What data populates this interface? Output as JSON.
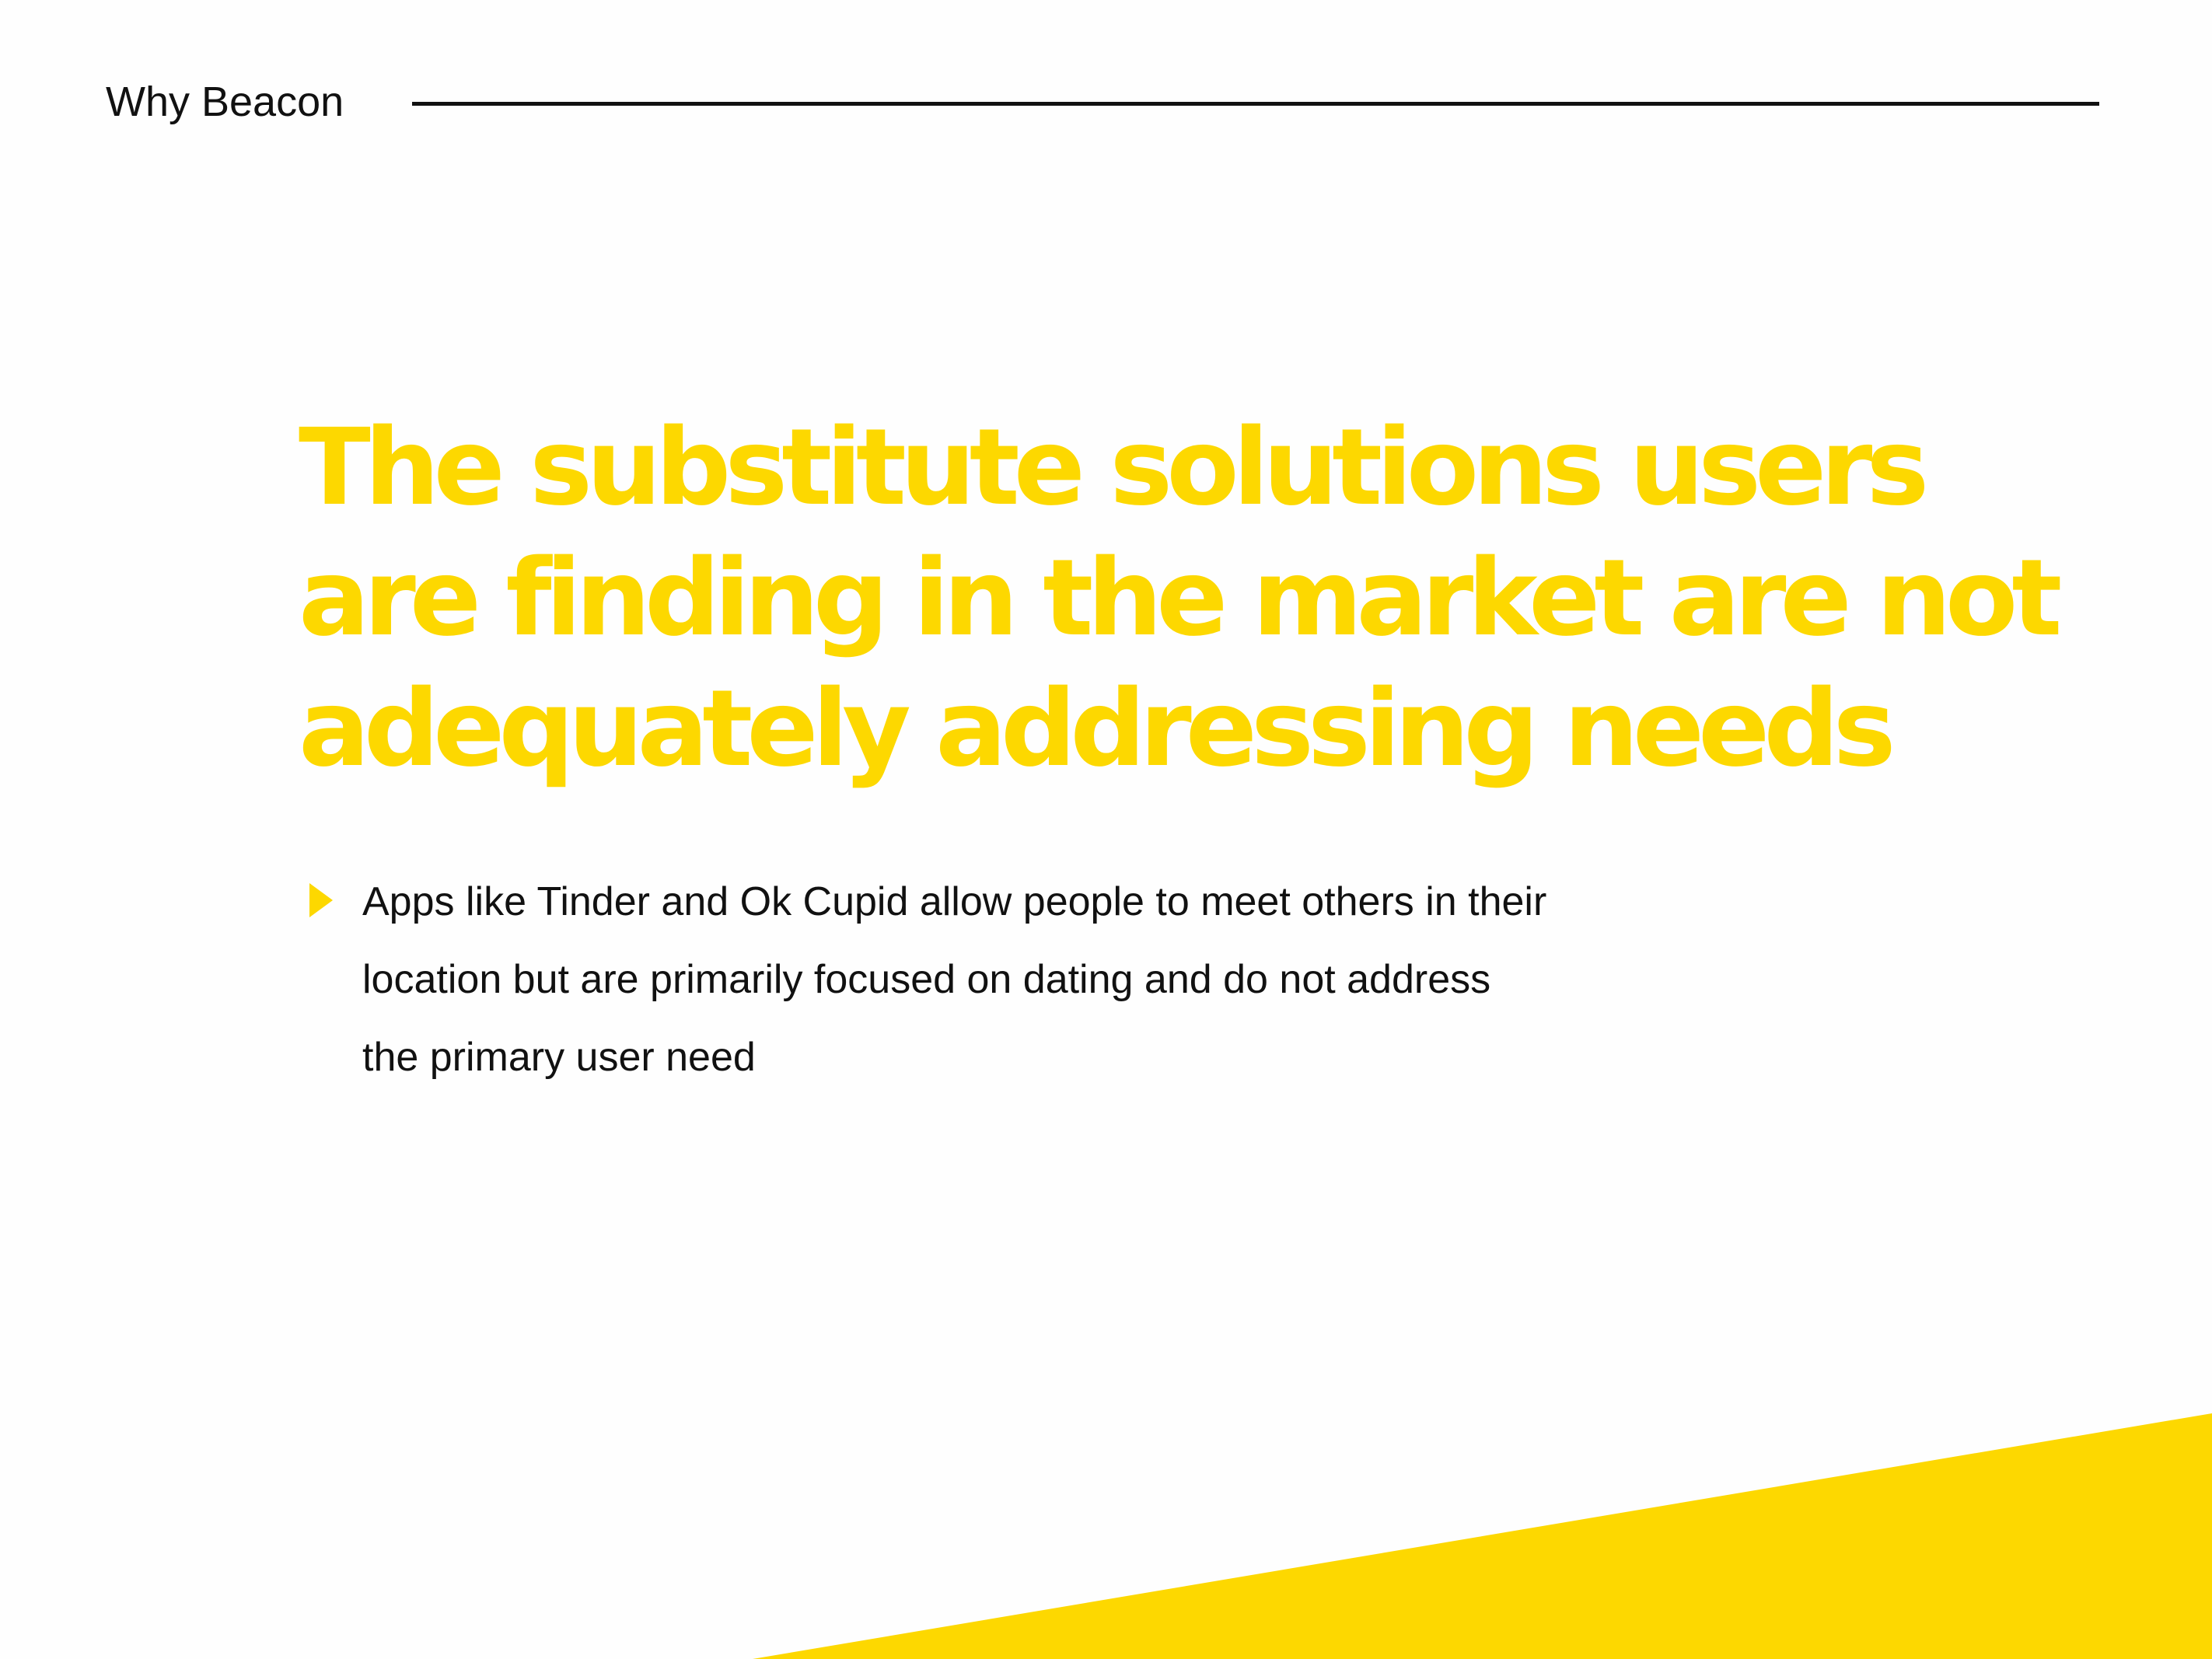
{
  "header": {
    "section_label": "Why Beacon"
  },
  "headline": {
    "lines": [
      "The substitute solutions users",
      "are finding in the market are not",
      "adequately addressing needs"
    ]
  },
  "bullets": [
    {
      "icon": "triangle-bullet-icon",
      "lines": [
        "Apps like Tinder and Ok Cupid allow people to meet others in their",
        "location but are primarily focused on dating and do not address",
        "the primary user need"
      ]
    }
  ],
  "colors": {
    "accent": "#fdd800",
    "text": "#111111",
    "background": "#fefefe"
  }
}
